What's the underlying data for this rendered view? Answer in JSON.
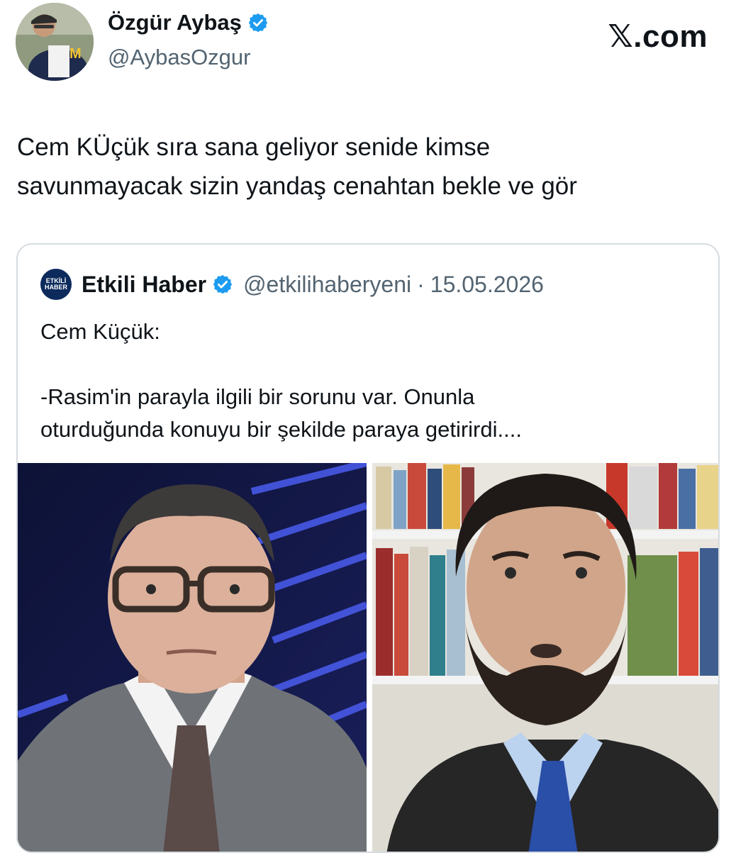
{
  "site_logo": "𝕏.com",
  "author": {
    "display_name": "Özgür Aybaş",
    "handle": "@AybasOzgur",
    "verified_icon": "verified-badge-icon",
    "avatar": "profile-avatar"
  },
  "tweet": {
    "lines": [
      "Cem KÜçük  sıra sana geliyor senide kimse",
      "savunmayacak sizin yandaş cenahtan bekle ve gör"
    ]
  },
  "quoted": {
    "logo_lines": [
      "ETKİLİ",
      "HABER"
    ],
    "display_name": "Etkili Haber",
    "handle": "@etkilihaberyeni",
    "separator": "·",
    "date": "15.05.2026",
    "lines": [
      "Cem Küçük:",
      "",
      "-Rasim'in parayla ilgili bir sorunu var. Onunla",
      "oturduğunda konuyu bir şekilde paraya getirirdi...."
    ],
    "images": [
      "photo-man-glasses-studio",
      "photo-man-beard-bookshelf"
    ]
  },
  "colors": {
    "text": "#0f1419",
    "secondary": "#536471",
    "verified_blue": "#1d9bf0",
    "border": "#d6dbdf"
  }
}
